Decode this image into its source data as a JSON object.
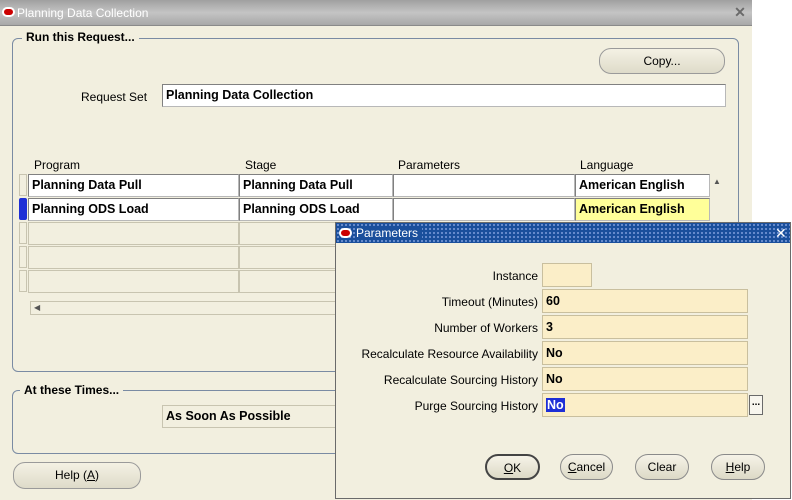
{
  "window": {
    "title": "Planning Data Collection",
    "close_glyph": "✕"
  },
  "run_request": {
    "frame_title": "Run this Request...",
    "copy_button": "Copy...",
    "request_set_label": "Request Set",
    "request_set_value": "Planning Data Collection",
    "columns": [
      "Program",
      "Stage",
      "Parameters",
      "Language"
    ],
    "rows": [
      {
        "program": "Planning Data Pull",
        "stage": "Planning Data Pull",
        "parameters": "",
        "language": "American English"
      },
      {
        "program": "Planning ODS Load",
        "stage": "Planning ODS Load",
        "parameters": "",
        "language": "American English"
      }
    ]
  },
  "times": {
    "frame_title": "At these Times...",
    "value": "As Soon As Possible"
  },
  "help_button": {
    "prefix": "Help (",
    "mnemonic": "A",
    "suffix": ")"
  },
  "parameters_dialog": {
    "title": "Parameters",
    "close_glyph": "✕",
    "fields": [
      {
        "label": "Instance",
        "value": ""
      },
      {
        "label": "Timeout (Minutes)",
        "value": "60"
      },
      {
        "label": "Number of Workers",
        "value": "3"
      },
      {
        "label": "Recalculate Resource Availability",
        "value": "No"
      },
      {
        "label": "Recalculate Sourcing History",
        "value": "No"
      },
      {
        "label": "Purge Sourcing History",
        "value": "No"
      }
    ],
    "lov_glyph": "...",
    "buttons": {
      "ok": {
        "mnemonic": "O",
        "rest": "K"
      },
      "cancel": {
        "mnemonic": "C",
        "rest": "ancel"
      },
      "clear": "Clear",
      "help": {
        "mnemonic": "H",
        "rest": "elp"
      }
    }
  },
  "colors": {
    "background": "#f2efdf",
    "selection": "#1e2fd6",
    "dialog_title": "#1a4f9c",
    "required_field": "#fbeec8",
    "current_field": "#ffff99"
  }
}
